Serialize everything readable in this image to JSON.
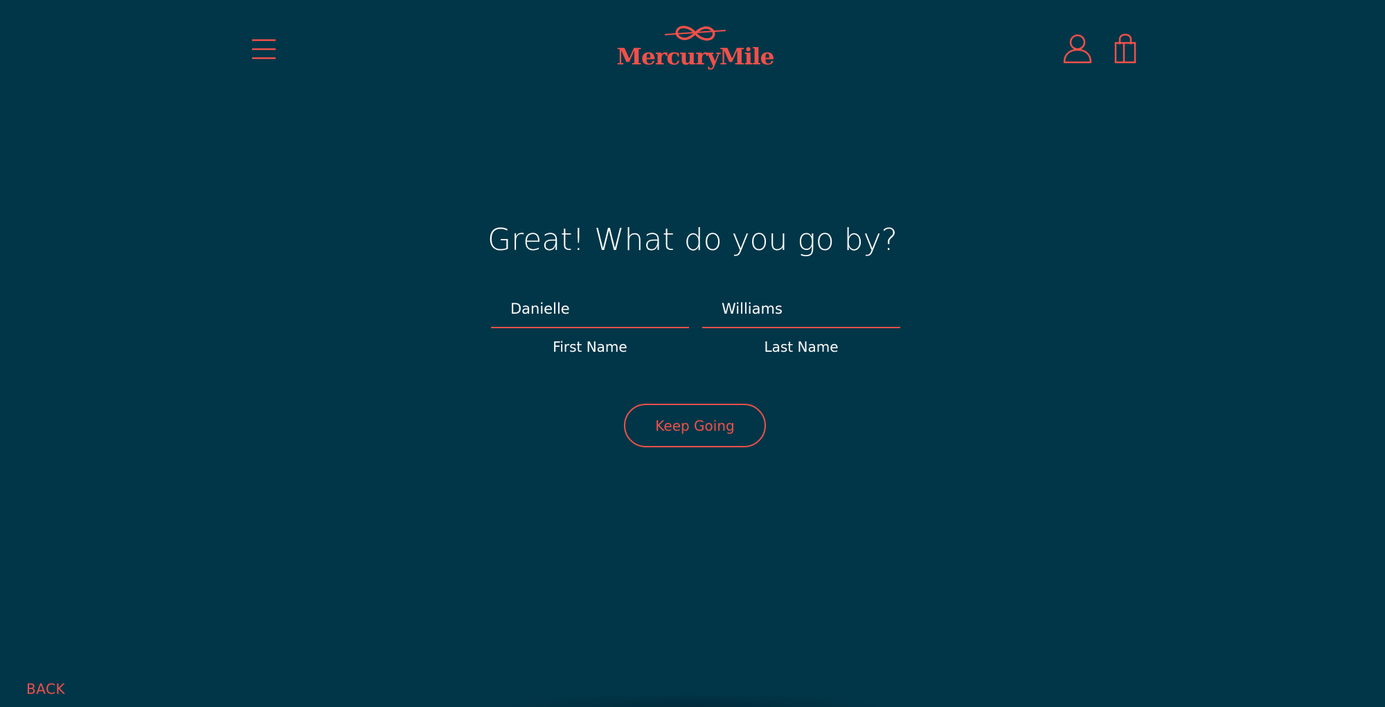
{
  "brand": {
    "name": "MercuryMile",
    "accent_color": "#f0504a",
    "background_color": "#013648"
  },
  "header": {
    "menu_icon": "hamburger-menu-icon",
    "account_icon": "user-account-icon",
    "bag_icon": "shopping-bag-icon"
  },
  "form": {
    "heading": "Great! What do you go by?",
    "first_name": {
      "value": "Danielle",
      "label": "First Name"
    },
    "last_name": {
      "value": "Williams",
      "label": "Last Name"
    },
    "submit_label": "Keep Going"
  },
  "footer": {
    "back_label": "BACK"
  }
}
